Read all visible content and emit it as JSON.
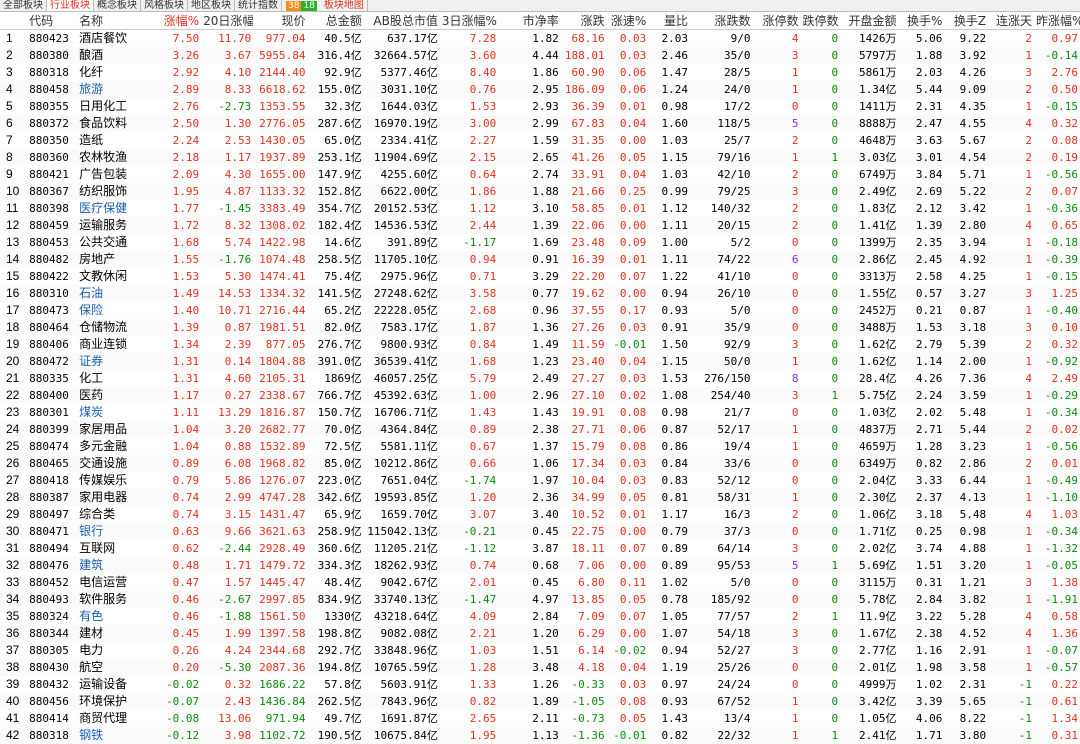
{
  "tabs": {
    "items": [
      "全部板块",
      "行业板块",
      "概念板块",
      "风格板块",
      "地区板块",
      "统计指数"
    ],
    "badge_up": "38",
    "badge_down": "18",
    "map": "板块地图",
    "active_index": 1
  },
  "columns": [
    "",
    "代码",
    "名称",
    "涨幅%",
    "20日涨幅%",
    "现价",
    "总金额",
    "AB股总市值",
    "3日涨幅%",
    "市净率",
    "涨跌",
    "涨速%",
    "量比",
    "涨跌数",
    "涨停数",
    "跌停数",
    "开盘金额",
    "换手%",
    "换手Z",
    "连涨天",
    "昨涨幅%"
  ],
  "rows": [
    [
      "1",
      "880423",
      "酒店餐饮",
      "7.50",
      "11.70",
      "977.04",
      "40.5亿",
      "637.17亿",
      "7.28",
      "1.82",
      "68.16",
      "0.03",
      "2.03",
      "9/0",
      "4",
      "0",
      "1426万",
      "5.06",
      "9.22",
      "2",
      "0.97"
    ],
    [
      "2",
      "880380",
      "酿酒",
      "3.26",
      "3.67",
      "5955.84",
      "316.4亿",
      "32664.57亿",
      "3.60",
      "4.44",
      "188.01",
      "0.03",
      "2.46",
      "35/0",
      "3",
      "0",
      "5797万",
      "1.88",
      "3.92",
      "1",
      "-0.14"
    ],
    [
      "3",
      "880318",
      "化纤",
      "2.92",
      "4.10",
      "2144.40",
      "92.9亿",
      "5377.46亿",
      "8.40",
      "1.86",
      "60.90",
      "0.06",
      "1.47",
      "28/5",
      "1",
      "0",
      "5861万",
      "2.03",
      "4.26",
      "3",
      "2.76"
    ],
    [
      "4",
      "880458",
      "旅游",
      "2.89",
      "8.33",
      "6618.62",
      "155.0亿",
      "3031.10亿",
      "0.76",
      "2.95",
      "186.09",
      "0.06",
      "1.24",
      "24/0",
      "1",
      "0",
      "1.34亿",
      "5.44",
      "9.09",
      "2",
      "0.50"
    ],
    [
      "5",
      "880355",
      "日用化工",
      "2.76",
      "-2.73",
      "1353.55",
      "32.3亿",
      "1644.03亿",
      "1.53",
      "2.93",
      "36.39",
      "0.01",
      "0.98",
      "17/2",
      "0",
      "0",
      "1411万",
      "2.31",
      "4.35",
      "1",
      "-0.15"
    ],
    [
      "6",
      "880372",
      "食品饮料",
      "2.50",
      "1.30",
      "2776.05",
      "287.6亿",
      "16970.19亿",
      "3.00",
      "2.99",
      "67.83",
      "0.04",
      "1.60",
      "118/5",
      "5",
      "0",
      "8888万",
      "2.47",
      "4.55",
      "4",
      "0.32"
    ],
    [
      "7",
      "880350",
      "造纸",
      "2.24",
      "2.53",
      "1430.05",
      "65.0亿",
      "2334.41亿",
      "2.27",
      "1.59",
      "31.35",
      "0.00",
      "1.03",
      "25/7",
      "2",
      "0",
      "4648万",
      "3.63",
      "5.67",
      "2",
      "0.08"
    ],
    [
      "8",
      "880360",
      "农林牧渔",
      "2.18",
      "1.17",
      "1937.89",
      "253.1亿",
      "11904.69亿",
      "2.15",
      "2.65",
      "41.26",
      "0.05",
      "1.15",
      "79/16",
      "1",
      "1",
      "3.03亿",
      "3.01",
      "4.54",
      "2",
      "0.19"
    ],
    [
      "9",
      "880421",
      "广告包装",
      "2.09",
      "4.30",
      "1655.00",
      "147.9亿",
      "4255.60亿",
      "0.64",
      "2.74",
      "33.91",
      "0.04",
      "1.03",
      "42/10",
      "2",
      "0",
      "6749万",
      "3.84",
      "5.71",
      "1",
      "-0.56"
    ],
    [
      "10",
      "880367",
      "纺织服饰",
      "1.95",
      "4.87",
      "1133.32",
      "152.8亿",
      "6622.00亿",
      "1.86",
      "1.88",
      "21.66",
      "0.25",
      "0.99",
      "79/25",
      "3",
      "0",
      "2.49亿",
      "2.69",
      "5.22",
      "2",
      "0.07"
    ],
    [
      "11",
      "880398",
      "医疗保健",
      "1.77",
      "-1.45",
      "3383.49",
      "354.7亿",
      "20152.53亿",
      "1.12",
      "3.10",
      "58.85",
      "0.01",
      "1.12",
      "140/32",
      "2",
      "0",
      "1.83亿",
      "2.12",
      "3.42",
      "1",
      "-0.36"
    ],
    [
      "12",
      "880459",
      "运输服务",
      "1.72",
      "8.32",
      "1308.02",
      "182.4亿",
      "14536.53亿",
      "2.44",
      "1.39",
      "22.06",
      "0.00",
      "1.11",
      "20/15",
      "2",
      "0",
      "1.41亿",
      "1.39",
      "2.80",
      "4",
      "0.65"
    ],
    [
      "13",
      "880453",
      "公共交通",
      "1.68",
      "5.74",
      "1422.98",
      "14.6亿",
      "391.89亿",
      "-1.17",
      "1.69",
      "23.48",
      "0.09",
      "1.00",
      "5/2",
      "0",
      "0",
      "1399万",
      "2.35",
      "3.94",
      "1",
      "-0.18"
    ],
    [
      "14",
      "880482",
      "房地产",
      "1.55",
      "-1.76",
      "1074.48",
      "258.5亿",
      "11705.10亿",
      "0.94",
      "0.91",
      "16.39",
      "0.01",
      "1.11",
      "74/22",
      "6",
      "0",
      "2.86亿",
      "2.45",
      "4.92",
      "1",
      "-0.39"
    ],
    [
      "15",
      "880422",
      "文教休闲",
      "1.53",
      "5.30",
      "1474.41",
      "75.4亿",
      "2975.96亿",
      "0.71",
      "3.29",
      "22.20",
      "0.07",
      "1.22",
      "41/10",
      "0",
      "0",
      "3313万",
      "2.58",
      "4.25",
      "1",
      "-0.15"
    ],
    [
      "16",
      "880310",
      "石油",
      "1.49",
      "14.53",
      "1334.32",
      "141.5亿",
      "27248.62亿",
      "3.58",
      "0.77",
      "19.62",
      "0.00",
      "0.94",
      "26/10",
      "0",
      "0",
      "1.55亿",
      "0.57",
      "3.27",
      "3",
      "1.25"
    ],
    [
      "17",
      "880473",
      "保险",
      "1.40",
      "10.71",
      "2716.44",
      "65.2亿",
      "22228.05亿",
      "2.68",
      "0.96",
      "37.55",
      "0.17",
      "0.93",
      "5/0",
      "0",
      "0",
      "2452万",
      "0.21",
      "0.87",
      "1",
      "-0.40"
    ],
    [
      "18",
      "880464",
      "仓储物流",
      "1.39",
      "0.87",
      "1981.51",
      "82.0亿",
      "7583.17亿",
      "1.87",
      "1.36",
      "27.26",
      "0.03",
      "0.91",
      "35/9",
      "0",
      "0",
      "3488万",
      "1.53",
      "3.18",
      "3",
      "0.10"
    ],
    [
      "19",
      "880406",
      "商业连锁",
      "1.34",
      "2.39",
      "877.05",
      "276.7亿",
      "9800.93亿",
      "0.84",
      "1.49",
      "11.59",
      "-0.01",
      "1.50",
      "92/9",
      "3",
      "0",
      "1.62亿",
      "2.79",
      "5.39",
      "2",
      "0.32"
    ],
    [
      "20",
      "880472",
      "证券",
      "1.31",
      "0.14",
      "1804.88",
      "391.0亿",
      "36539.41亿",
      "1.68",
      "1.23",
      "23.40",
      "0.04",
      "1.15",
      "50/0",
      "1",
      "0",
      "1.62亿",
      "1.14",
      "2.00",
      "1",
      "-0.92"
    ],
    [
      "21",
      "880335",
      "化工",
      "1.31",
      "4.60",
      "2105.31",
      "1869亿",
      "46057.25亿",
      "5.79",
      "2.49",
      "27.27",
      "0.03",
      "1.53",
      "276/150",
      "8",
      "0",
      "28.4亿",
      "4.26",
      "7.36",
      "4",
      "2.49"
    ],
    [
      "22",
      "880400",
      "医药",
      "1.17",
      "0.27",
      "2338.67",
      "766.7亿",
      "45392.63亿",
      "1.00",
      "2.96",
      "27.10",
      "0.02",
      "1.08",
      "254/40",
      "3",
      "1",
      "5.75亿",
      "2.24",
      "3.59",
      "1",
      "-0.29"
    ],
    [
      "23",
      "880301",
      "煤炭",
      "1.11",
      "13.29",
      "1816.87",
      "150.7亿",
      "16706.71亿",
      "1.43",
      "1.43",
      "19.91",
      "0.08",
      "0.98",
      "21/7",
      "0",
      "0",
      "1.03亿",
      "2.02",
      "5.48",
      "1",
      "-0.34"
    ],
    [
      "24",
      "880399",
      "家居用品",
      "1.04",
      "3.20",
      "2682.77",
      "70.0亿",
      "4364.84亿",
      "0.89",
      "2.38",
      "27.71",
      "0.06",
      "0.87",
      "52/17",
      "1",
      "0",
      "4837万",
      "2.71",
      "5.44",
      "2",
      "0.02"
    ],
    [
      "25",
      "880474",
      "多元金融",
      "1.04",
      "0.88",
      "1532.89",
      "72.5亿",
      "5581.11亿",
      "0.67",
      "1.37",
      "15.79",
      "0.08",
      "0.86",
      "19/4",
      "1",
      "0",
      "4659万",
      "1.28",
      "3.23",
      "1",
      "-0.56"
    ],
    [
      "26",
      "880465",
      "交通设施",
      "0.89",
      "6.08",
      "1968.82",
      "85.0亿",
      "10212.86亿",
      "0.66",
      "1.06",
      "17.34",
      "0.03",
      "0.84",
      "33/6",
      "0",
      "0",
      "6349万",
      "0.82",
      "2.86",
      "2",
      "0.01"
    ],
    [
      "27",
      "880418",
      "传媒娱乐",
      "0.79",
      "5.86",
      "1276.07",
      "223.0亿",
      "7651.04亿",
      "-1.74",
      "1.97",
      "10.04",
      "0.03",
      "0.83",
      "52/12",
      "0",
      "0",
      "2.04亿",
      "3.33",
      "6.44",
      "1",
      "-0.49"
    ],
    [
      "28",
      "880387",
      "家用电器",
      "0.74",
      "2.99",
      "4747.28",
      "342.6亿",
      "19593.85亿",
      "1.20",
      "2.36",
      "34.99",
      "0.05",
      "0.81",
      "58/31",
      "1",
      "0",
      "2.30亿",
      "2.37",
      "4.13",
      "1",
      "-1.10"
    ],
    [
      "29",
      "880497",
      "综合类",
      "0.74",
      "3.15",
      "1431.47",
      "65.9亿",
      "1659.70亿",
      "3.07",
      "3.40",
      "10.52",
      "0.01",
      "1.17",
      "16/3",
      "2",
      "0",
      "1.06亿",
      "3.18",
      "5.48",
      "4",
      "1.03"
    ],
    [
      "30",
      "880471",
      "银行",
      "0.63",
      "9.66",
      "3621.63",
      "258.9亿",
      "115042.13亿",
      "-0.21",
      "0.45",
      "22.75",
      "0.00",
      "0.79",
      "37/3",
      "0",
      "0",
      "1.71亿",
      "0.25",
      "0.98",
      "1",
      "-0.34"
    ],
    [
      "31",
      "880494",
      "互联网",
      "0.62",
      "-2.44",
      "2928.49",
      "360.6亿",
      "11205.21亿",
      "-1.12",
      "3.87",
      "18.11",
      "0.07",
      "0.89",
      "64/14",
      "3",
      "0",
      "2.02亿",
      "3.74",
      "4.88",
      "1",
      "-1.32"
    ],
    [
      "32",
      "880476",
      "建筑",
      "0.48",
      "1.71",
      "1479.72",
      "334.3亿",
      "18262.93亿",
      "0.74",
      "0.68",
      "7.06",
      "0.00",
      "0.89",
      "95/53",
      "5",
      "1",
      "5.69亿",
      "1.51",
      "3.20",
      "1",
      "-0.05"
    ],
    [
      "33",
      "880452",
      "电信运营",
      "0.47",
      "1.57",
      "1445.47",
      "48.4亿",
      "9042.67亿",
      "2.01",
      "0.45",
      "6.80",
      "0.11",
      "1.02",
      "5/0",
      "0",
      "0",
      "3115万",
      "0.31",
      "1.21",
      "3",
      "1.38"
    ],
    [
      "34",
      "880493",
      "软件服务",
      "0.46",
      "-2.67",
      "2997.85",
      "834.9亿",
      "33740.13亿",
      "-1.47",
      "4.97",
      "13.85",
      "0.05",
      "0.78",
      "185/92",
      "0",
      "0",
      "5.78亿",
      "2.84",
      "3.82",
      "1",
      "-1.91"
    ],
    [
      "35",
      "880324",
      "有色",
      "0.46",
      "-1.88",
      "1561.50",
      "1330亿",
      "43218.64亿",
      "4.09",
      "2.84",
      "7.09",
      "0.07",
      "1.05",
      "77/57",
      "2",
      "1",
      "11.9亿",
      "3.22",
      "5.28",
      "4",
      "0.58"
    ],
    [
      "36",
      "880344",
      "建材",
      "0.45",
      "1.99",
      "1397.58",
      "198.8亿",
      "9082.08亿",
      "2.21",
      "1.20",
      "6.29",
      "0.00",
      "1.07",
      "54/18",
      "3",
      "0",
      "1.67亿",
      "2.38",
      "4.52",
      "4",
      "1.36"
    ],
    [
      "37",
      "880305",
      "电力",
      "0.26",
      "4.24",
      "2344.68",
      "292.7亿",
      "33848.96亿",
      "1.03",
      "1.51",
      "6.14",
      "-0.02",
      "0.94",
      "52/27",
      "3",
      "0",
      "2.77亿",
      "1.16",
      "2.91",
      "1",
      "-0.07"
    ],
    [
      "38",
      "880430",
      "航空",
      "0.20",
      "-5.30",
      "2087.36",
      "194.8亿",
      "10765.59亿",
      "1.28",
      "3.48",
      "4.18",
      "0.04",
      "1.19",
      "25/26",
      "0",
      "0",
      "2.01亿",
      "1.98",
      "3.58",
      "1",
      "-0.57"
    ],
    [
      "39",
      "880432",
      "运输设备",
      "-0.02",
      "0.32",
      "1686.22",
      "57.8亿",
      "5603.91亿",
      "1.33",
      "1.26",
      "-0.33",
      "0.03",
      "0.97",
      "24/24",
      "0",
      "0",
      "4999万",
      "1.02",
      "2.31",
      "-1",
      "0.22"
    ],
    [
      "40",
      "880456",
      "环境保护",
      "-0.07",
      "2.43",
      "1436.84",
      "262.5亿",
      "7843.96亿",
      "0.82",
      "1.89",
      "-1.05",
      "0.08",
      "0.93",
      "67/52",
      "1",
      "0",
      "3.42亿",
      "3.39",
      "5.65",
      "-1",
      "0.61"
    ],
    [
      "41",
      "880414",
      "商贸代理",
      "-0.08",
      "13.06",
      "971.94",
      "49.7亿",
      "1691.87亿",
      "2.65",
      "2.11",
      "-0.73",
      "0.05",
      "1.43",
      "13/4",
      "1",
      "0",
      "1.05亿",
      "4.06",
      "8.22",
      "-1",
      "1.34"
    ],
    [
      "42",
      "880318",
      "钢铁",
      "-0.12",
      "3.98",
      "1102.72",
      "190.5亿",
      "10675.84亿",
      "1.95",
      "1.13",
      "-1.36",
      "-0.01",
      "0.82",
      "22/32",
      "1",
      "1",
      "2.41亿",
      "1.71",
      "3.80",
      "-1",
      "0.31"
    ]
  ],
  "blue_names": [
    "旅游",
    "医疗保健",
    "石油",
    "保险",
    "证券",
    "煤炭",
    "银行",
    "建筑",
    "有色",
    "钢铁"
  ],
  "colors": {
    "up": "#e0301e",
    "down": "#0a8a0a",
    "link": "#1a5fb4",
    "limit": "#8a2be2"
  }
}
